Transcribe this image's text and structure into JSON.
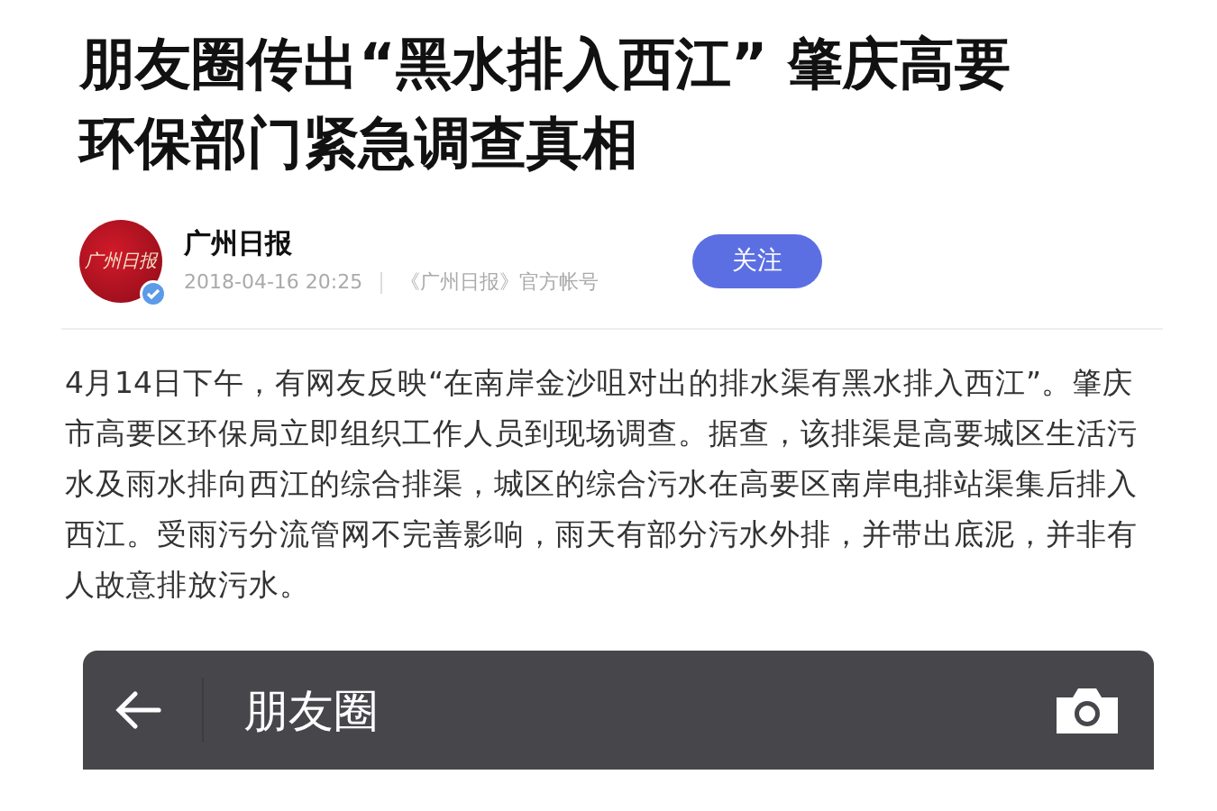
{
  "article": {
    "title_lines": [
      "朋友圈传出“黑水排入西江” 肇庆高要",
      "环保部门紧急调查真相"
    ],
    "author": {
      "avatar_text": "广州日报",
      "verified": true,
      "name": "广州日报",
      "time": "2018-04-16 20:25",
      "source": "《广州日报》官方帐号",
      "follow_label": "关注"
    },
    "body": "4月14日下午，有网友反映“在南岸金沙咀对出的排水渠有黑水排入西江”。肇庆市高要区环保局立即组织工作人员到现场调查。据查，该排渠是高要城区生活污水及雨水排向西江的综合排渠，城区的综合污水在高要区南岸电排站渠集后排入西江。受雨污分流管网不完善影响，雨天有部分污水外排，并带出底泥，并非有人故意排放污水。",
    "embedded_screen": {
      "title": "朋友圈"
    }
  }
}
